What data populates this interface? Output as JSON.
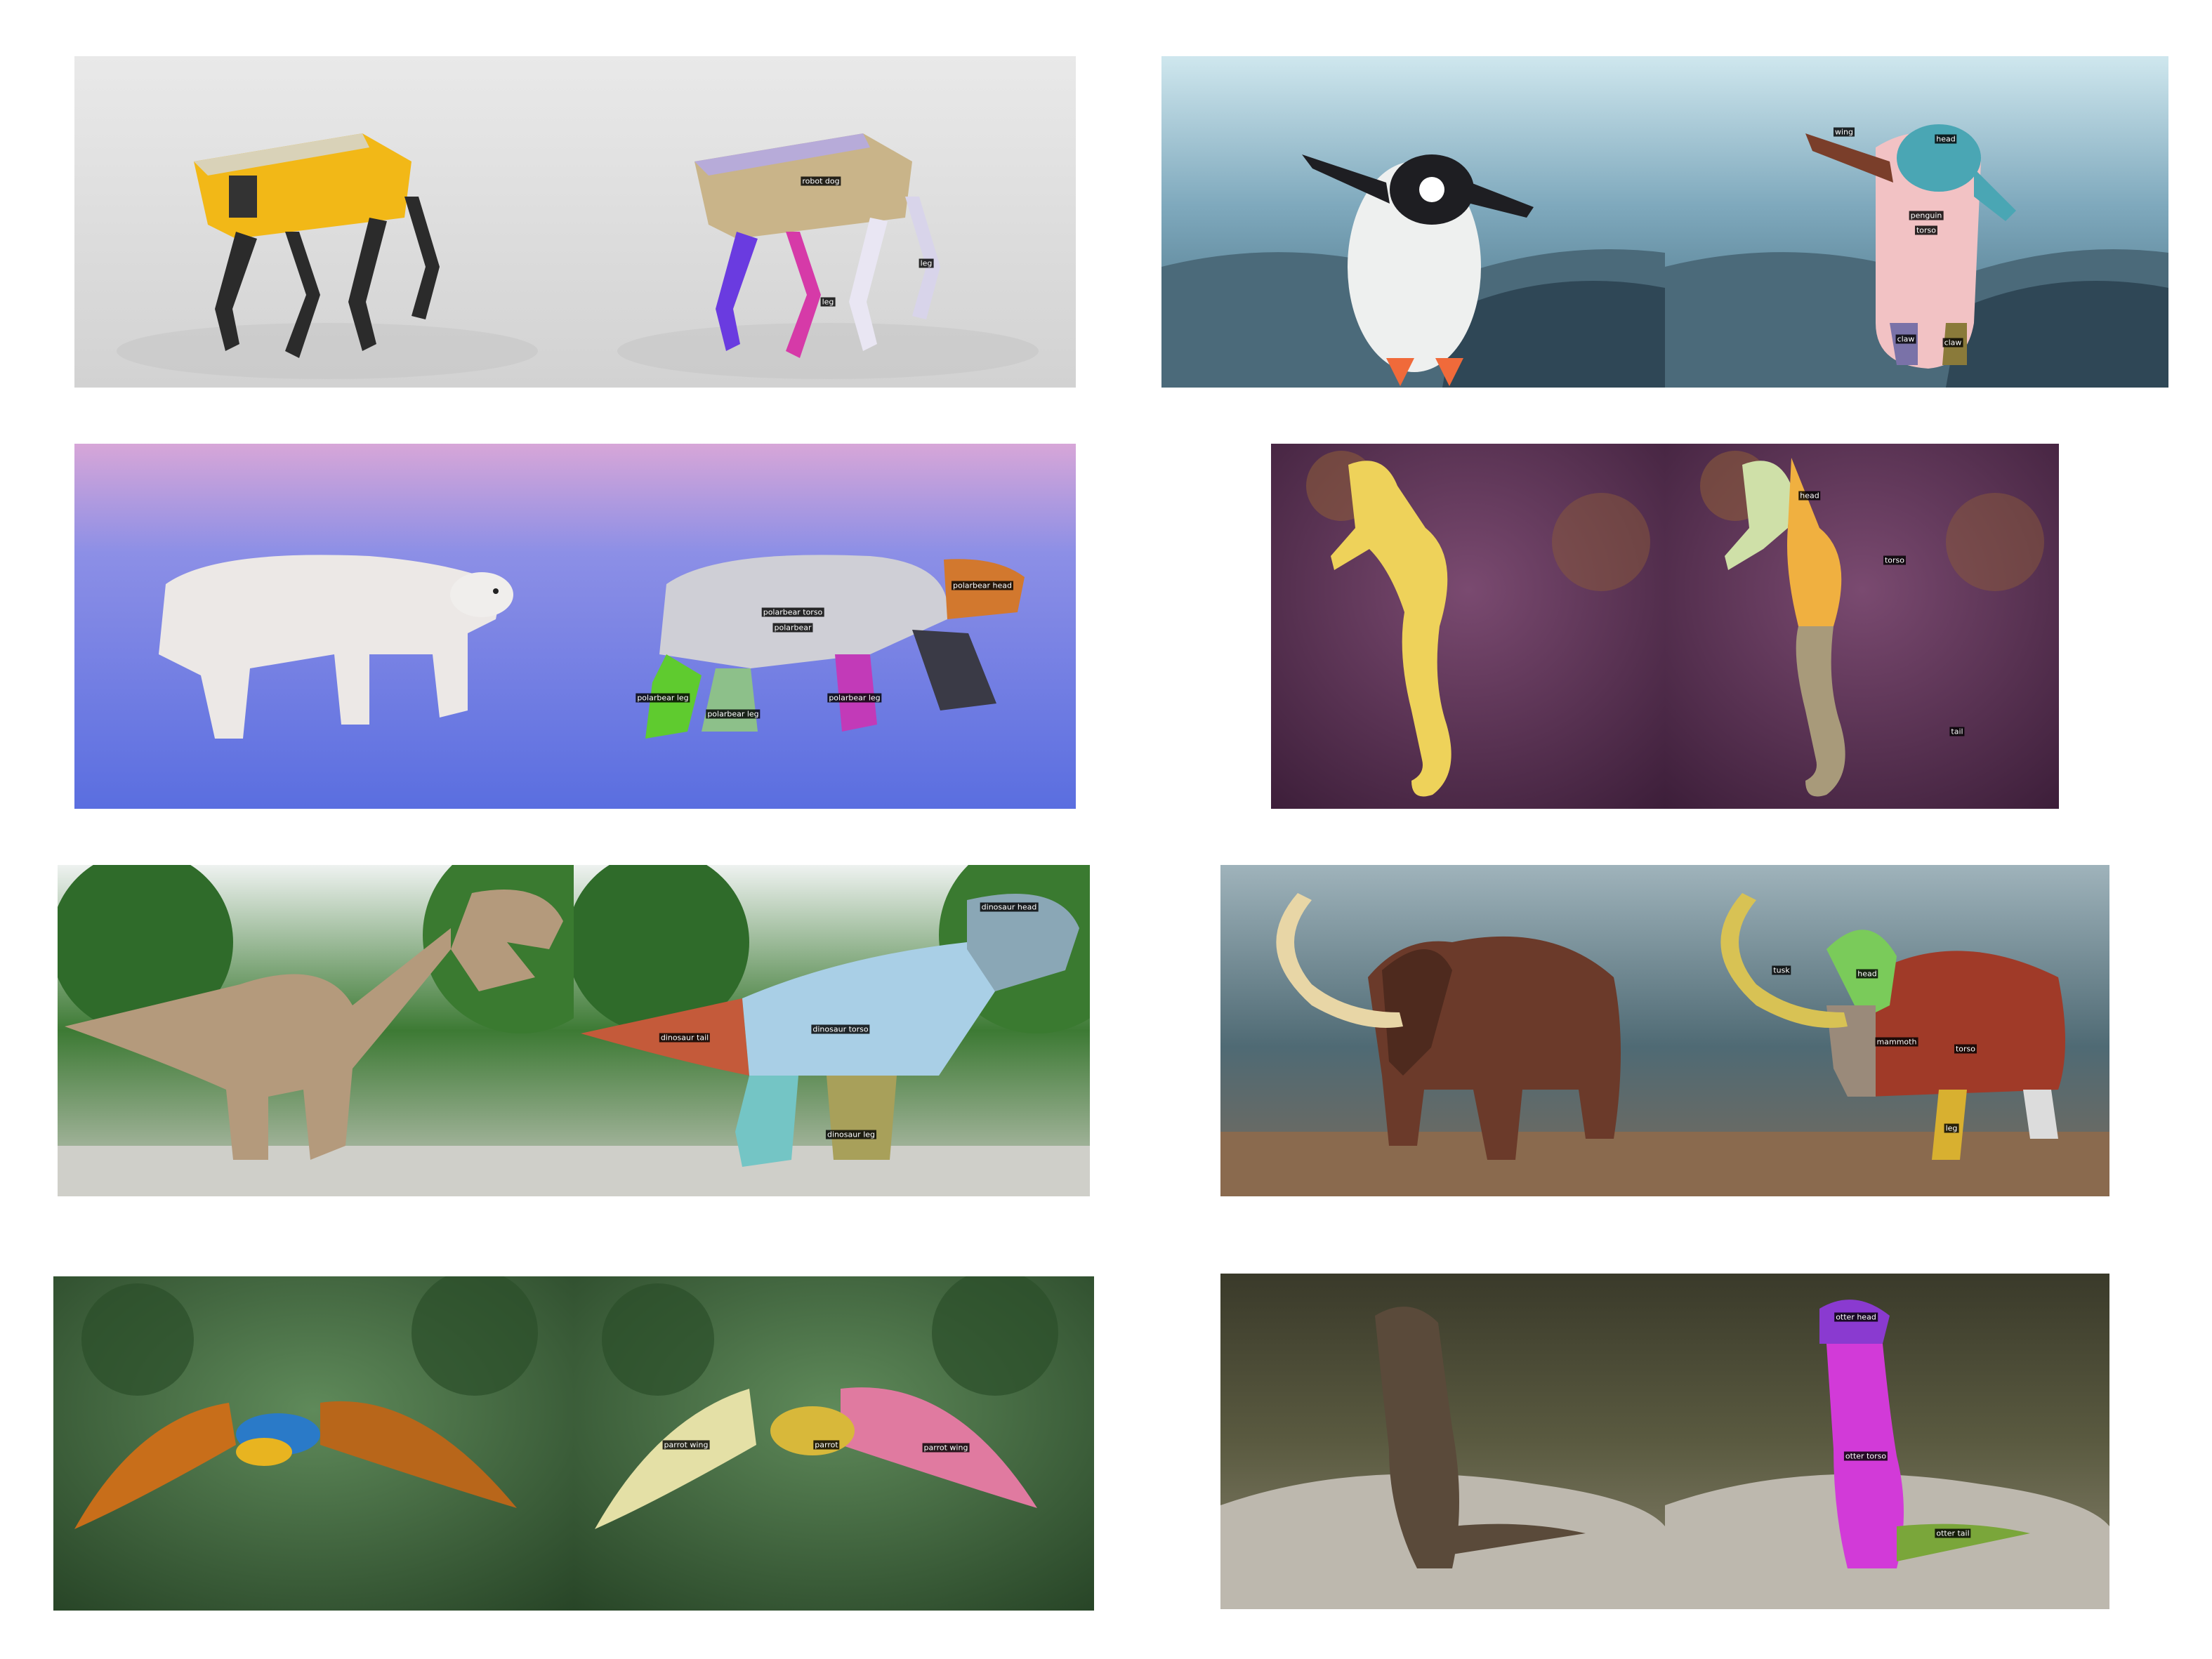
{
  "panels": {
    "robot_dog": {
      "labels": {
        "body": "robot dog",
        "leg_a": "leg",
        "leg_b": "leg"
      }
    },
    "penguin": {
      "labels": {
        "head": "head",
        "torso": "torso",
        "wing": "wing",
        "claw_a": "claw",
        "claw_b": "claw",
        "wing_b": "penguin"
      }
    },
    "polar_bear": {
      "labels": {
        "head": "polarbear head",
        "torso": "polarbear torso",
        "body": "polarbear",
        "leg_a": "polarbear leg",
        "leg_b": "polarbear leg",
        "leg_c": "polarbear leg"
      }
    },
    "seahorse": {
      "labels": {
        "head": "head",
        "torso": "torso",
        "tail": "tail"
      }
    },
    "dinosaur": {
      "labels": {
        "head": "dinosaur head",
        "torso": "dinosaur torso",
        "tail": "dinosaur tail",
        "leg": "dinosaur leg"
      }
    },
    "mammoth": {
      "labels": {
        "tusk": "tusk",
        "head": "head",
        "body": "mammoth",
        "torso": "torso",
        "leg_a": "leg"
      }
    },
    "parrot": {
      "labels": {
        "wing_a": "parrot wing",
        "wing_b": "parrot wing",
        "body": "parrot"
      }
    },
    "otter": {
      "labels": {
        "head": "otter head",
        "torso": "otter torso",
        "tail": "otter tail"
      }
    }
  },
  "colors": {
    "background": "#ffffff",
    "robot_yellow": "#f2b817",
    "polar_bear_sky": "#6f7fe0",
    "seahorse_bg": "#5a2d52",
    "forest_green": "#2f6b2a",
    "parrot_bg": "#3d6a3a"
  }
}
